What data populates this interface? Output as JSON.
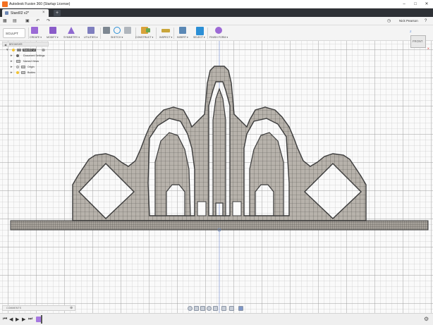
{
  "window": {
    "title": "Autodesk Fusion 360 (Startup License)",
    "minimize": "–",
    "maximize": "□",
    "close": "✕"
  },
  "document_tab": {
    "label": "Stard02 v2*",
    "close": "×",
    "new_tab": "+"
  },
  "quick_access": {
    "grid": "▦",
    "file": "▤",
    "save": "▣",
    "undo": "↶",
    "redo": "↷",
    "clock": "◷",
    "user": "Nick Pearson",
    "help": "?"
  },
  "workspace": {
    "label": "SCULPT"
  },
  "ribbon": {
    "groups": [
      {
        "label": "CREATE ▾",
        "color": "#9b6ad6"
      },
      {
        "label": "MODIFY ▾",
        "color": "#8a5cc9"
      },
      {
        "label": "SYMMETRY ▾",
        "color": "#8f6ad0"
      },
      {
        "label": "UTILITIES ▾",
        "color": "#7f7fbf"
      },
      {
        "label": "SKETCH ▾",
        "color": "#7d8791"
      },
      {
        "label": "CONSTRUCT ▾",
        "color": "#d9a33a"
      },
      {
        "label": "INSPECT ▾",
        "color": "#c9a53a"
      },
      {
        "label": "INSERT ▾",
        "color": "#5a88b5"
      },
      {
        "label": "SELECT ▾",
        "color": "#2b8fd6"
      },
      {
        "label": "FINISH FORM ▾",
        "color": "#9d6ad6"
      }
    ]
  },
  "browser": {
    "title": "BROWSER",
    "root": "Stard02 v2",
    "items": [
      {
        "label": "Document Settings"
      },
      {
        "label": "Named Views"
      },
      {
        "label": "Origin"
      },
      {
        "label": "Bodies"
      }
    ]
  },
  "viewcube": {
    "face": "FRONT",
    "axis_z": "Z",
    "axis_x": "X"
  },
  "comments": {
    "label": "COMMENTS",
    "add": "⊕"
  },
  "timeline": {
    "first": "⏮",
    "prev": "◀",
    "play": "▶",
    "next": "▶",
    "last": "⏭",
    "settings": "⚙"
  },
  "colors": {
    "model_fill": "#b7b2ab",
    "model_stroke": "#3b3b3b",
    "dark_strip": "#2e3136",
    "accent_orange": "#f37021"
  }
}
